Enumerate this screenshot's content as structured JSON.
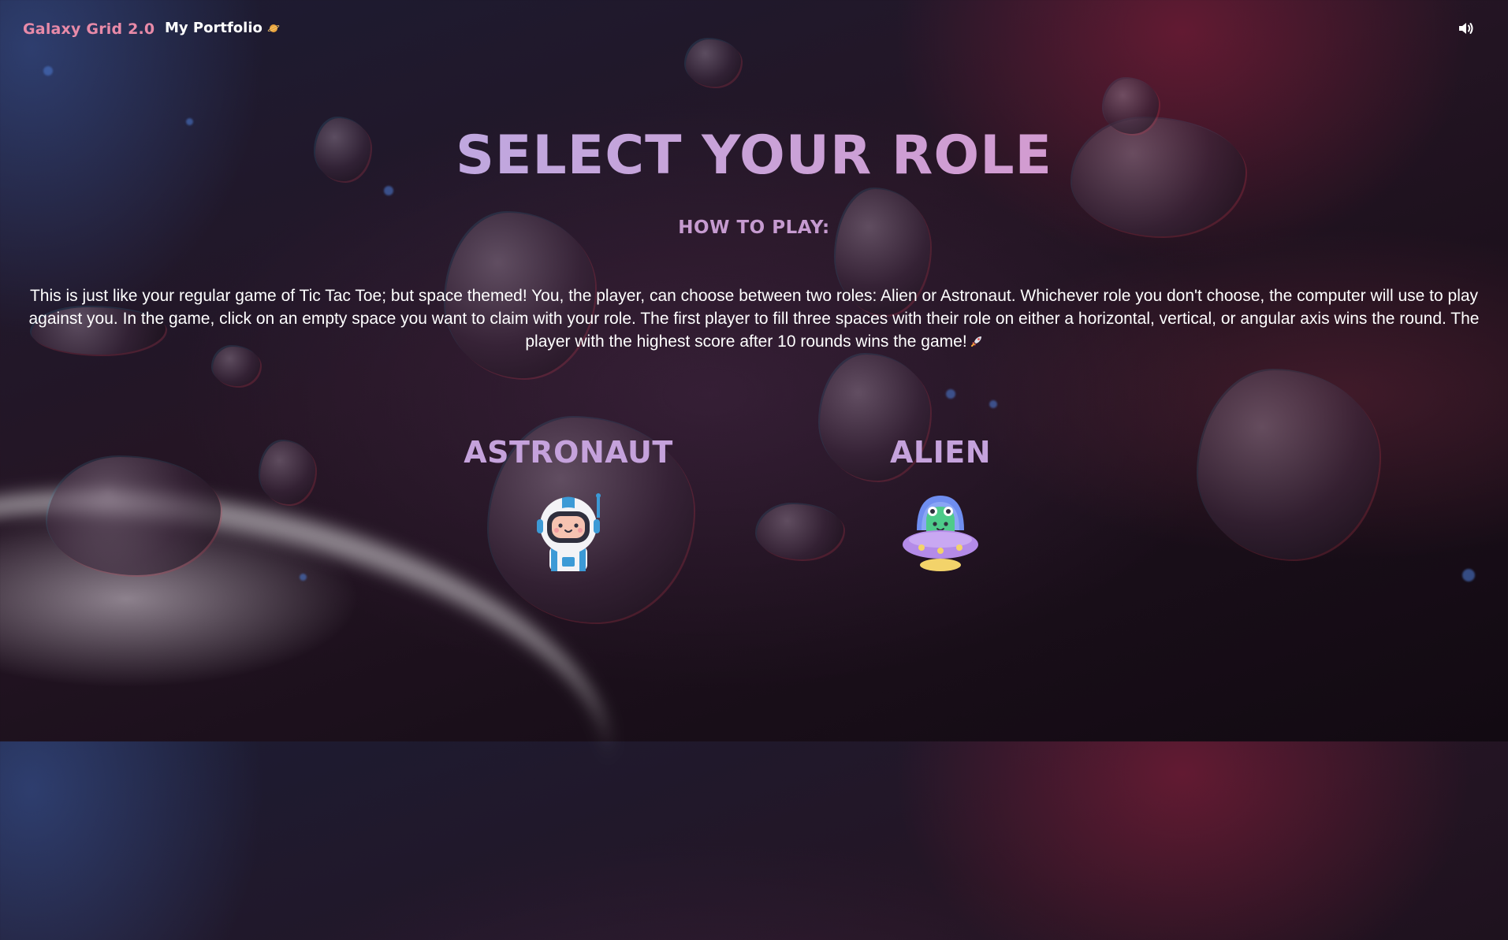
{
  "header": {
    "brand": "Galaxy Grid 2.0",
    "portfolio_link": "My Portfolio",
    "portfolio_icon": "planet-icon",
    "sound_icon": "speaker-volume-icon"
  },
  "main": {
    "title": "SELECT YOUR ROLE",
    "how_to_play_heading": "HOW TO PLAY:",
    "instructions": "This is just like your regular game of Tic Tac Toe; but space themed! You, the player, can choose between two roles: Alien or Astronaut. Whichever role you don't choose, the computer will use to play against you. In the game, click on an empty space you want to claim with your role. The first player to fill three spaces with their role on either a horizontal, vertical, or angular axis wins the round. The player with the highest score after 10 rounds wins the game!",
    "instructions_icon": "rocket-icon",
    "roles": [
      {
        "label": "ASTRONAUT",
        "icon": "astronaut-icon"
      },
      {
        "label": "ALIEN",
        "icon": "alien-ufo-icon"
      }
    ]
  },
  "colors": {
    "brand": "#e88aa8",
    "title_gradient_start": "#b1b0ea",
    "title_gradient_end": "#e190c5",
    "heading": "#c69bd0",
    "role_label": "#c5a2dc"
  }
}
